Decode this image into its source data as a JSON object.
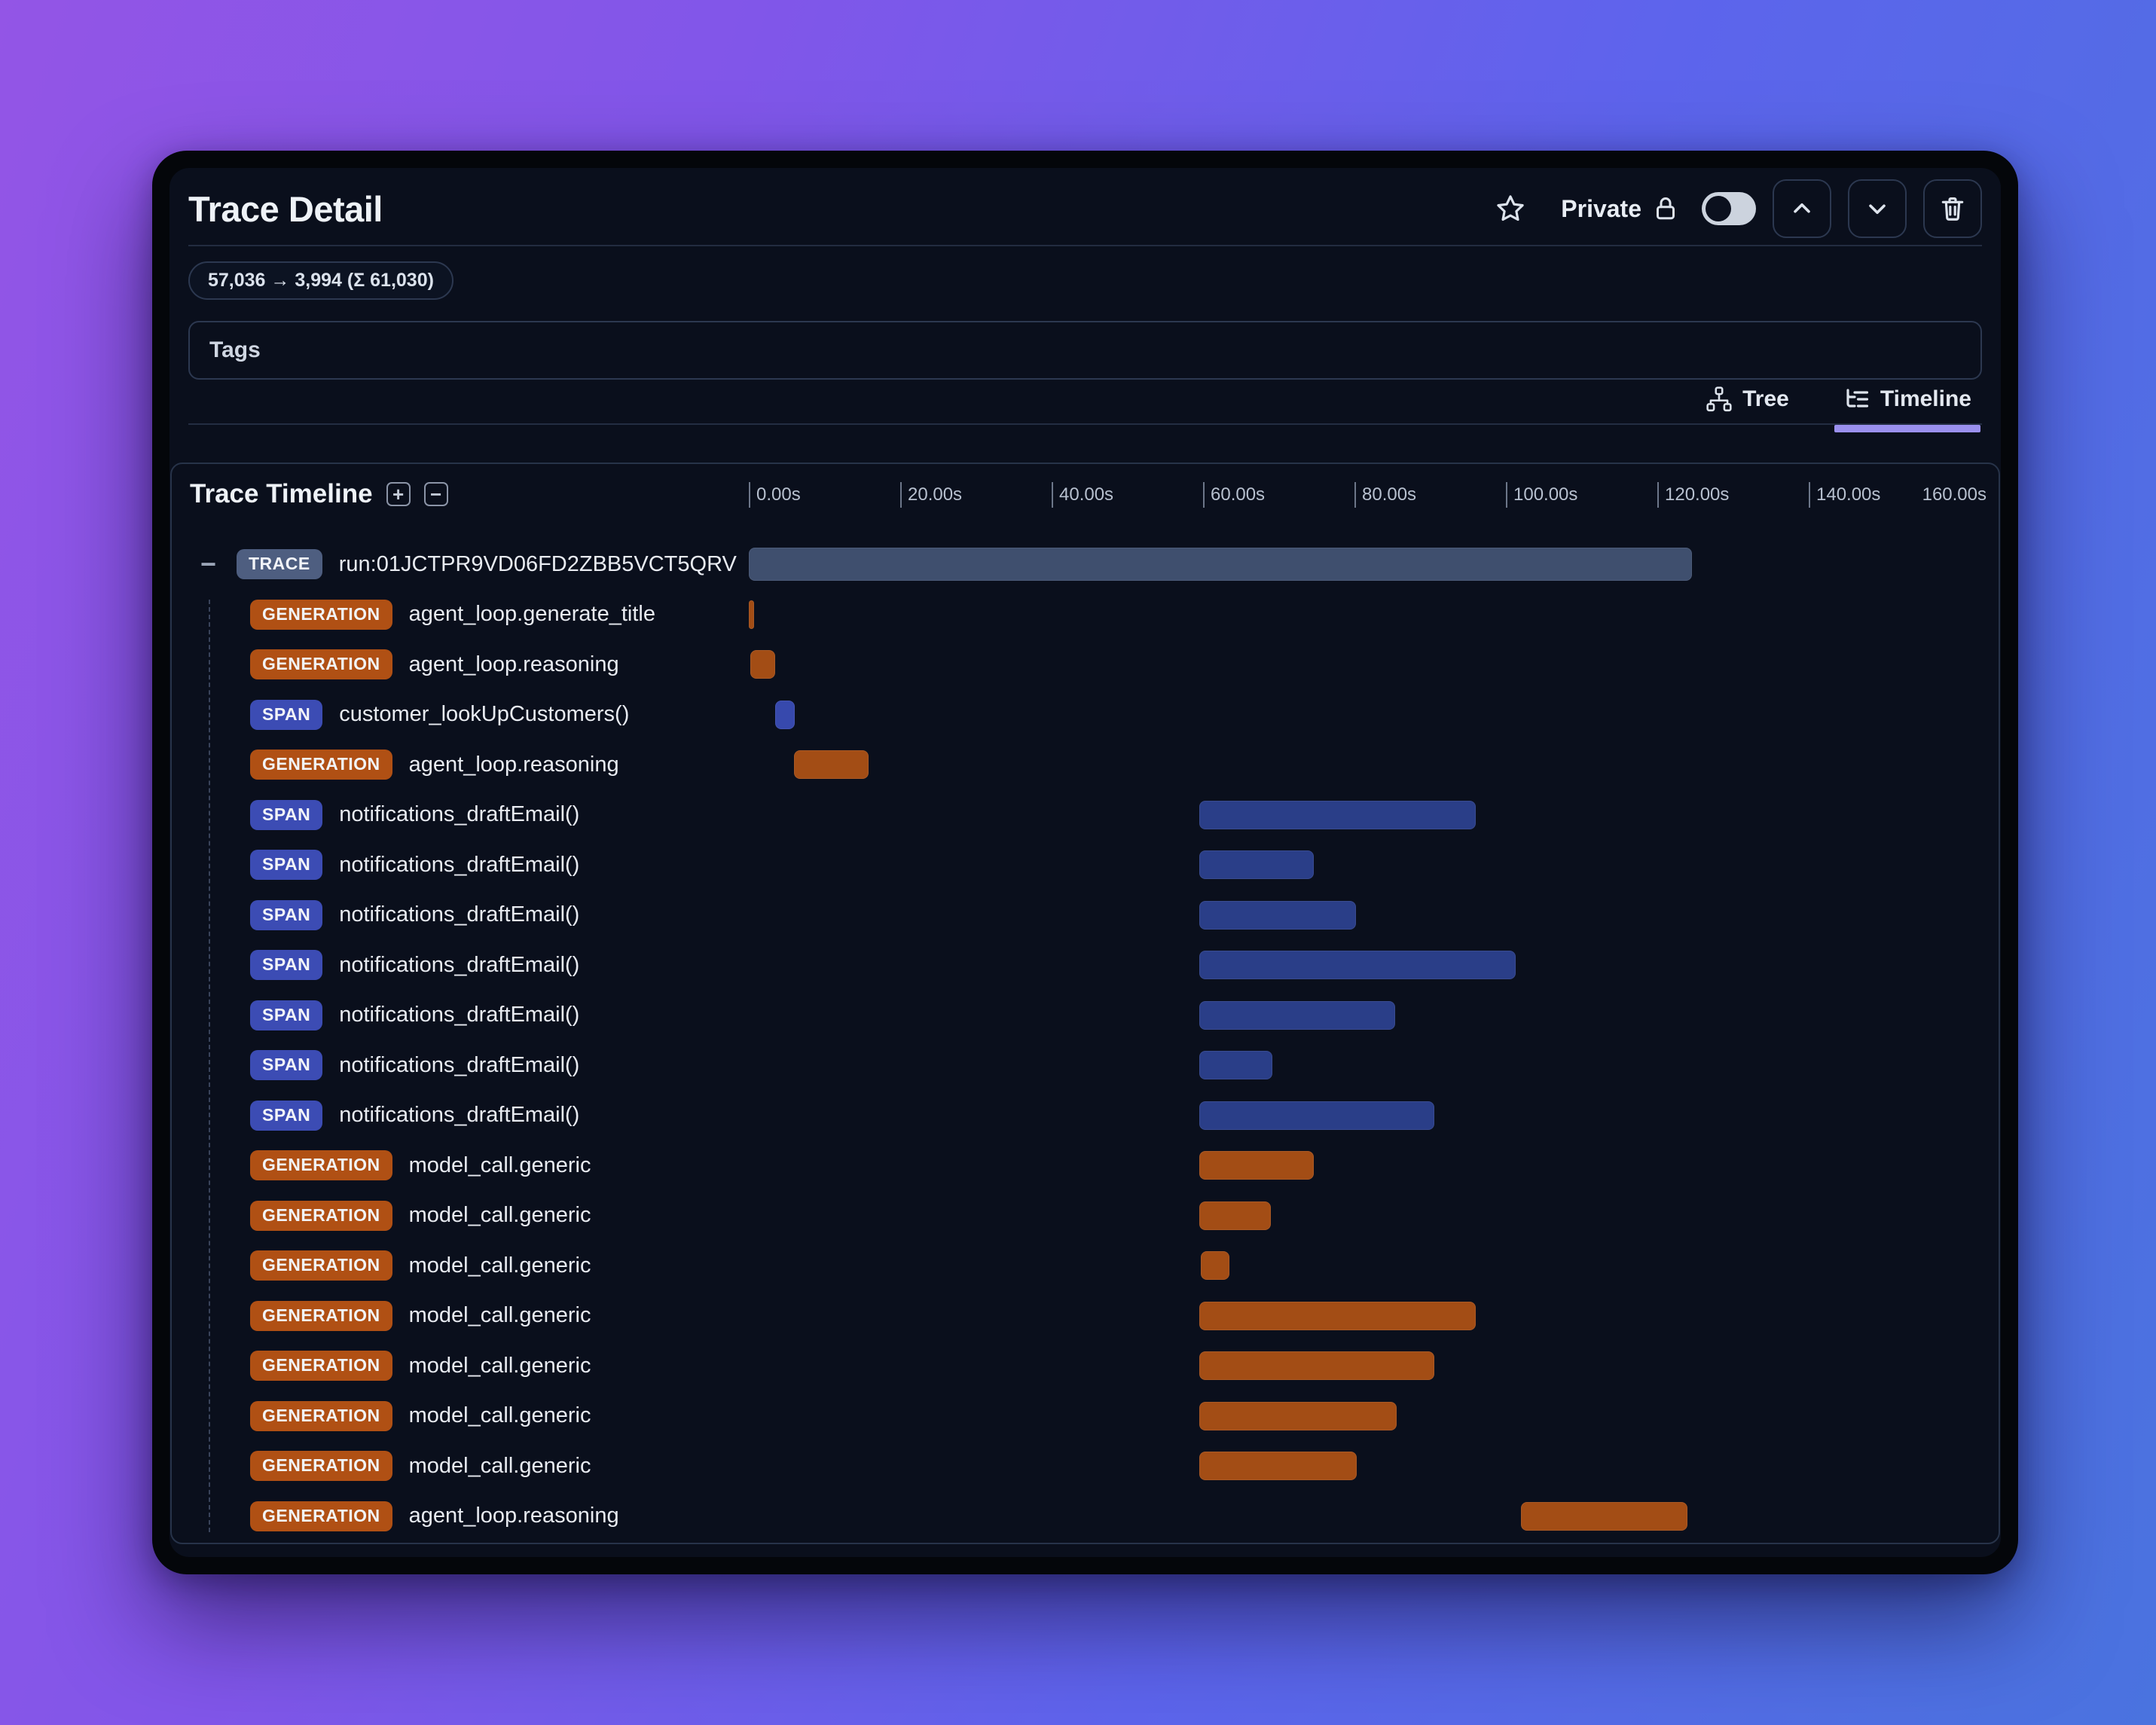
{
  "header": {
    "title": "Trace Detail",
    "privacy_label": "Private",
    "token_badge": "57,036 → 3,994 (Σ 61,030)",
    "icons": [
      "star-icon",
      "lock-icon",
      "chevron-up-icon",
      "chevron-down-icon",
      "trash-icon"
    ],
    "privacy_toggle_on": false
  },
  "tags": {
    "label": "Tags"
  },
  "view_tabs": {
    "tree_label": "Tree",
    "timeline_label": "Timeline",
    "active": "Timeline",
    "icons": [
      "tree-icon",
      "list-tree-icon"
    ]
  },
  "timeline_panel": {
    "title": "Trace Timeline",
    "expand_all_glyph": "+",
    "collapse_all_glyph": "−",
    "trace_collapse_glyph": "−",
    "axis": {
      "tick_labels": [
        "0.00s",
        "20.00s",
        "40.00s",
        "60.00s",
        "80.00s",
        "100.00s",
        "120.00s",
        "140.00s"
      ],
      "end_label": "160.00s",
      "tick_interval_seconds": 20,
      "max_seconds": 160
    },
    "rows": [
      {
        "type": "TRACE",
        "name": "run:01JCTPR9VD06FD2ZBB5VCT5QRV",
        "start_s": 0,
        "end_s": 124.6,
        "bar_color": "#3f4f6e"
      },
      {
        "type": "GENERATION",
        "name": "agent_loop.generate_title",
        "start_s": 0,
        "end_s": 0.7,
        "bar_color": "#a34d15"
      },
      {
        "type": "GENERATION",
        "name": "agent_loop.reasoning",
        "start_s": 0.2,
        "end_s": 3.5,
        "bar_color": "#a34d15"
      },
      {
        "type": "SPAN",
        "name": "customer_lookUpCustomers()",
        "start_s": 3.5,
        "end_s": 6.1,
        "bar_color": "#3749ad"
      },
      {
        "type": "GENERATION",
        "name": "agent_loop.reasoning",
        "start_s": 6.0,
        "end_s": 15.8,
        "bar_color": "#a34d15"
      },
      {
        "type": "SPAN",
        "name": "notifications_draftEmail()",
        "start_s": 59.5,
        "end_s": 96.0,
        "bar_color": "#2a3e88"
      },
      {
        "type": "SPAN",
        "name": "notifications_draftEmail()",
        "start_s": 59.5,
        "end_s": 74.6,
        "bar_color": "#2a3e88"
      },
      {
        "type": "SPAN",
        "name": "notifications_draftEmail()",
        "start_s": 59.5,
        "end_s": 80.2,
        "bar_color": "#2a3e88"
      },
      {
        "type": "SPAN",
        "name": "notifications_draftEmail()",
        "start_s": 59.5,
        "end_s": 101.3,
        "bar_color": "#2a3e88"
      },
      {
        "type": "SPAN",
        "name": "notifications_draftEmail()",
        "start_s": 59.5,
        "end_s": 85.4,
        "bar_color": "#2a3e88"
      },
      {
        "type": "SPAN",
        "name": "notifications_draftEmail()",
        "start_s": 59.5,
        "end_s": 69.2,
        "bar_color": "#2a3e88"
      },
      {
        "type": "SPAN",
        "name": "notifications_draftEmail()",
        "start_s": 59.5,
        "end_s": 90.5,
        "bar_color": "#2a3e88"
      },
      {
        "type": "GENERATION",
        "name": "model_call.generic",
        "start_s": 59.5,
        "end_s": 74.6,
        "bar_color": "#a34d15"
      },
      {
        "type": "GENERATION",
        "name": "model_call.generic",
        "start_s": 59.5,
        "end_s": 69.0,
        "bar_color": "#a34d15"
      },
      {
        "type": "GENERATION",
        "name": "model_call.generic",
        "start_s": 59.7,
        "end_s": 63.5,
        "bar_color": "#a34d15"
      },
      {
        "type": "GENERATION",
        "name": "model_call.generic",
        "start_s": 59.5,
        "end_s": 96.0,
        "bar_color": "#a34d15"
      },
      {
        "type": "GENERATION",
        "name": "model_call.generic",
        "start_s": 59.5,
        "end_s": 90.5,
        "bar_color": "#a34d15"
      },
      {
        "type": "GENERATION",
        "name": "model_call.generic",
        "start_s": 59.5,
        "end_s": 85.6,
        "bar_color": "#a34d15"
      },
      {
        "type": "GENERATION",
        "name": "model_call.generic",
        "start_s": 59.5,
        "end_s": 80.3,
        "bar_color": "#a34d15"
      },
      {
        "type": "GENERATION",
        "name": "agent_loop.reasoning",
        "start_s": 102.0,
        "end_s": 124.0,
        "bar_color": "#a34d15"
      }
    ]
  },
  "colors": {
    "badge_trace": "#4e5e80",
    "badge_generation": "#b05014",
    "badge_span": "#3c4cb4",
    "bar_trace": "#3f4f6e",
    "bar_generation": "#a34d15",
    "bar_span": "#2a3e88",
    "bar_span_bright": "#3749ad",
    "tab_active_underline": "#9a90ee",
    "panel_background": "#0a0f1c",
    "background_gradient_start": "#9355e6",
    "background_gradient_end": "#4a73df"
  }
}
